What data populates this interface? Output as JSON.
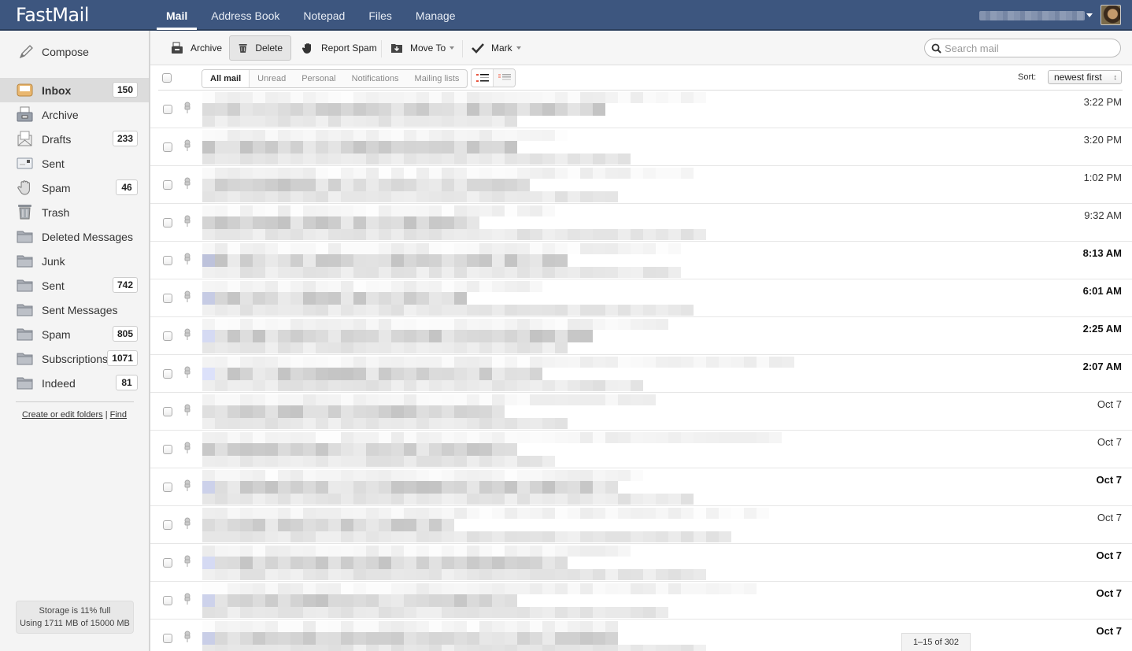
{
  "app": {
    "name": "FastMail"
  },
  "nav": {
    "tabs": [
      {
        "label": "Mail",
        "active": true
      },
      {
        "label": "Address Book",
        "active": false
      },
      {
        "label": "Notepad",
        "active": false
      },
      {
        "label": "Files",
        "active": false
      },
      {
        "label": "Manage",
        "active": false
      }
    ],
    "user_menu_icon": "chevron-down-icon",
    "avatar_icon": "user-avatar"
  },
  "sidebar": {
    "compose_label": "Compose",
    "folders": [
      {
        "label": "Inbox",
        "count": "150",
        "icon": "inbox-icon",
        "active": true
      },
      {
        "label": "Archive",
        "count": "",
        "icon": "archive-icon"
      },
      {
        "label": "Drafts",
        "count": "233",
        "icon": "drafts-icon"
      },
      {
        "label": "Sent",
        "count": "",
        "icon": "sent-icon"
      },
      {
        "label": "Spam",
        "count": "46",
        "icon": "spam-hand-icon"
      },
      {
        "label": "Trash",
        "count": "",
        "icon": "trash-icon"
      },
      {
        "label": "Deleted Messages",
        "count": "",
        "icon": "folder-icon"
      },
      {
        "label": "Junk",
        "count": "",
        "icon": "folder-icon"
      },
      {
        "label": "Sent",
        "count": "742",
        "icon": "folder-icon"
      },
      {
        "label": "Sent Messages",
        "count": "",
        "icon": "folder-icon"
      },
      {
        "label": "Spam",
        "count": "805",
        "icon": "folder-icon"
      },
      {
        "label": "Subscriptions",
        "count": "1071",
        "icon": "folder-icon"
      },
      {
        "label": "Indeed",
        "count": "81",
        "icon": "folder-icon"
      }
    ],
    "links": {
      "edit_folders": "Create or edit folders",
      "separator": "|",
      "find": "Find"
    },
    "storage": {
      "line1": "Storage is 11% full",
      "line2": "Using 1711 MB of 15000 MB",
      "percent_full": 11
    }
  },
  "toolbar": {
    "archive": "Archive",
    "delete": "Delete",
    "report_spam": "Report Spam",
    "move_to": "Move To",
    "mark": "Mark",
    "search_placeholder": "Search mail"
  },
  "filters": {
    "items": [
      "All mail",
      "Unread",
      "Personal",
      "Notifications",
      "Mailing lists"
    ],
    "active": "All mail",
    "sort_label": "Sort:",
    "sort_value": "newest first"
  },
  "messages": [
    {
      "date": "3:22 PM",
      "unread": false
    },
    {
      "date": "3:20 PM",
      "unread": false
    },
    {
      "date": "1:02 PM",
      "unread": false
    },
    {
      "date": "9:32 AM",
      "unread": false
    },
    {
      "date": "8:13 AM",
      "unread": true
    },
    {
      "date": "6:01 AM",
      "unread": true
    },
    {
      "date": "2:25 AM",
      "unread": true
    },
    {
      "date": "2:07 AM",
      "unread": true
    },
    {
      "date": "Oct 7",
      "unread": false
    },
    {
      "date": "Oct 7",
      "unread": false
    },
    {
      "date": "Oct 7",
      "unread": true
    },
    {
      "date": "Oct 7",
      "unread": false
    },
    {
      "date": "Oct 7",
      "unread": true
    },
    {
      "date": "Oct 7",
      "unread": true
    },
    {
      "date": "Oct 7",
      "unread": true
    }
  ],
  "pager": "1–15 of 302"
}
